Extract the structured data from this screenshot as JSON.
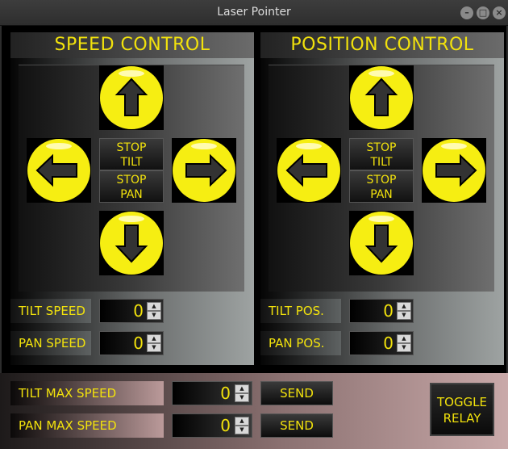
{
  "window": {
    "title": "Laser Pointer"
  },
  "speed": {
    "title": "SPEED CONTROL",
    "stop_tilt": [
      "STOP",
      "TILT"
    ],
    "stop_pan": [
      "STOP",
      "PAN"
    ],
    "tilt_label": "TILT SPEED",
    "tilt_value": "0",
    "pan_label": "PAN SPEED",
    "pan_value": "0"
  },
  "position": {
    "title": "POSITION CONTROL",
    "stop_tilt": [
      "STOP",
      "TILT"
    ],
    "stop_pan": [
      "STOP",
      "PAN"
    ],
    "tilt_label": "TILT POS.",
    "tilt_value": "0",
    "pan_label": "PAN POS.",
    "pan_value": "0"
  },
  "max": {
    "tilt_label": "TILT MAX SPEED",
    "tilt_value": "0",
    "pan_label": "PAN MAX SPEED",
    "pan_value": "0",
    "send_label": "SEND"
  },
  "relay": {
    "label": [
      "TOGGLE",
      "RELAY"
    ]
  },
  "colors": {
    "accent": "#f2e20c",
    "arrow_fill": "#333333"
  },
  "icons": {
    "up": "arrow-up-icon",
    "down": "arrow-down-icon",
    "left": "arrow-left-icon",
    "right": "arrow-right-icon",
    "spin_up": "spin-up-icon",
    "spin_down": "spin-down-icon"
  }
}
